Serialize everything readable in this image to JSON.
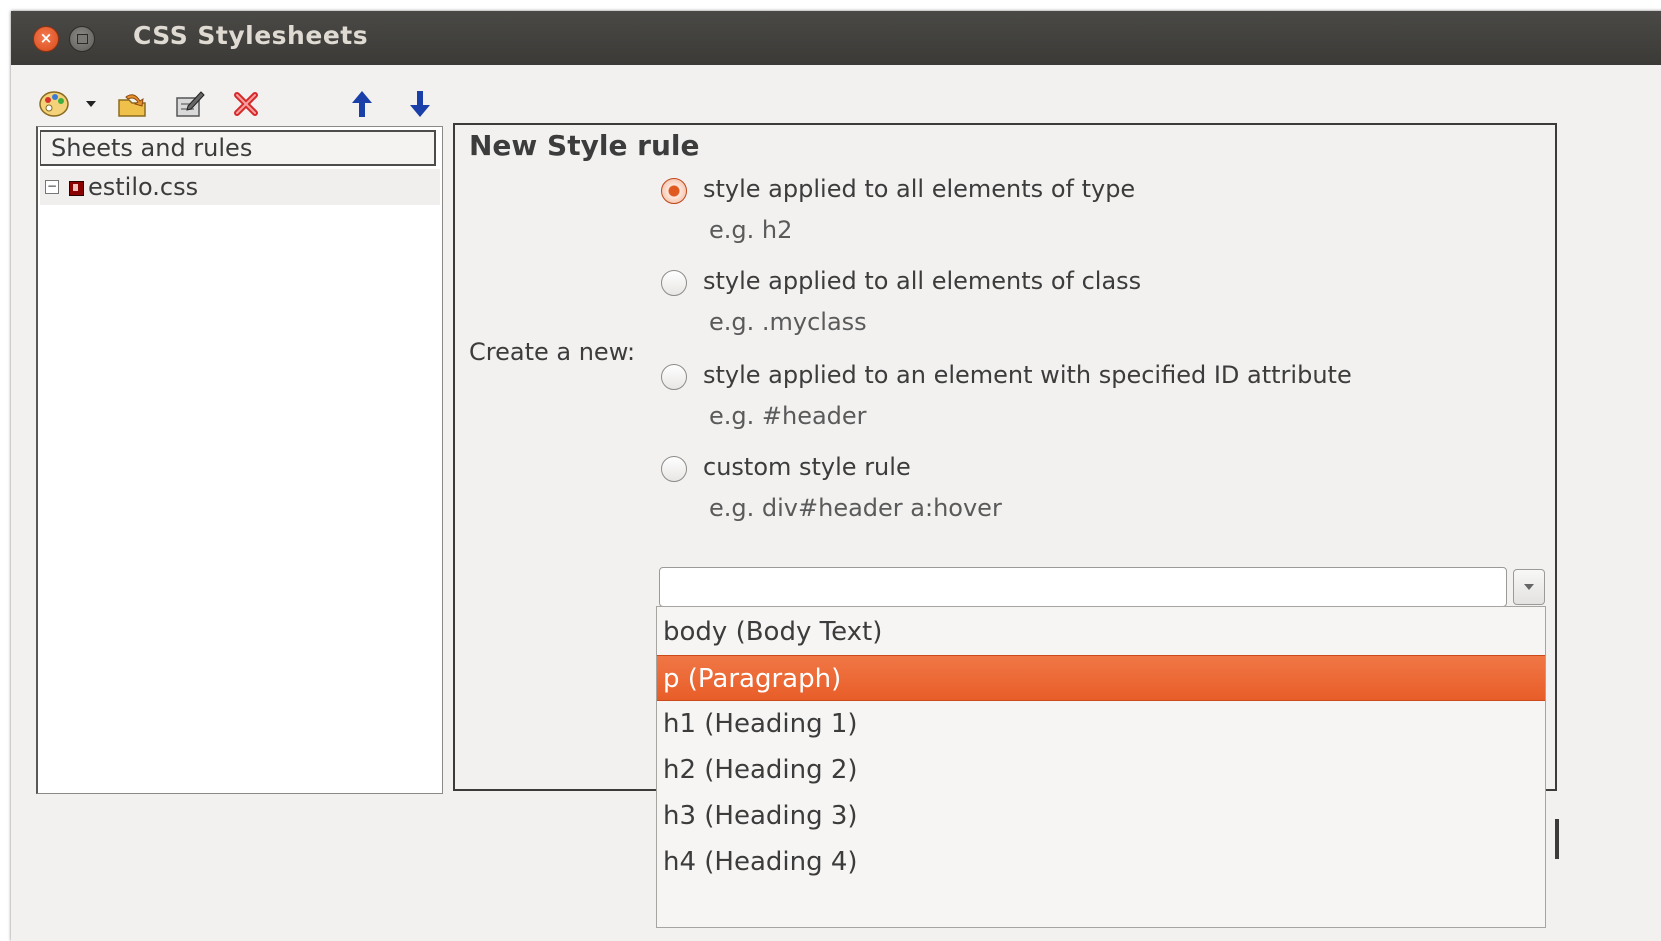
{
  "window": {
    "title": "CSS Stylesheets"
  },
  "toolbar": {
    "icons": [
      "palette-icon",
      "dropdown-arrow-icon",
      "import-icon",
      "edit-icon",
      "delete-icon",
      "move-up-icon",
      "move-down-icon"
    ]
  },
  "tree": {
    "header": "Sheets and rules",
    "items": [
      {
        "label": "estilo.css",
        "expanded": true
      }
    ]
  },
  "panel": {
    "title": "New Style rule",
    "create_label": "Create a new:",
    "options": [
      {
        "label": "style applied to all elements of type",
        "hint": "e.g. h2",
        "checked": true
      },
      {
        "label": "style applied to all elements of class",
        "hint": "e.g. .myclass",
        "checked": false
      },
      {
        "label": "style applied to an element with specified ID attribute",
        "hint": "e.g. #header",
        "checked": false
      },
      {
        "label": "custom style rule",
        "hint": "e.g. div#header a:hover",
        "checked": false
      }
    ],
    "combo_value": ""
  },
  "dropdown": {
    "items": [
      "body (Body Text)",
      "p (Paragraph)",
      "h1 (Heading 1)",
      "h2 (Heading 2)",
      "h3 (Heading 3)",
      "h4 (Heading 4)"
    ],
    "selected": "p (Paragraph)"
  },
  "colors": {
    "accent": "#e8622c",
    "titlebar": "#3c3b37",
    "window_bg": "#f2f1f0"
  }
}
